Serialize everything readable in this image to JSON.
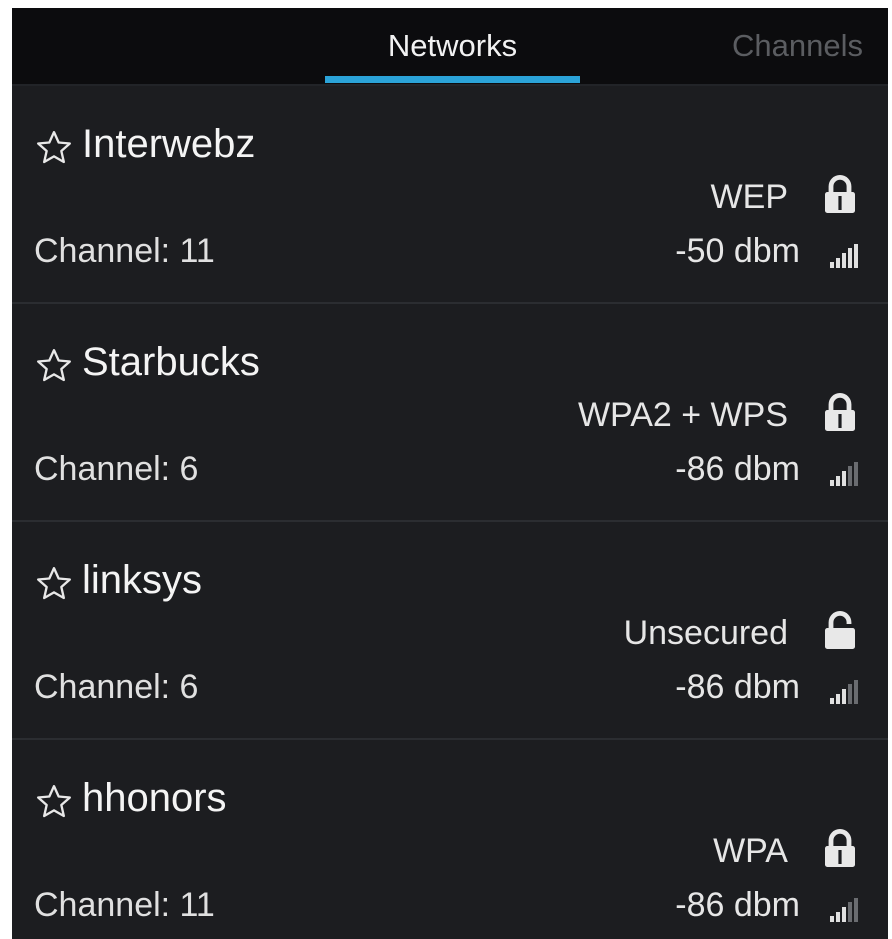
{
  "tabs": {
    "networks": "Networks",
    "channels": "Channels",
    "active": "networks"
  },
  "colors": {
    "background": "#1c1d20",
    "tabbar": "#0c0c0e",
    "accent": "#2ba3d8",
    "text": "#f2f2f2",
    "inactive_tab": "#5b5d61"
  },
  "networks": [
    {
      "ssid": "Interwebz",
      "security": "WEP",
      "channel": "Channel: 11",
      "signal": "-50 dbm",
      "star_icon": "star-outline-icon",
      "lock_icon": "lock-closed-icon",
      "signal_icon": "signal-bars-icon"
    },
    {
      "ssid": "Starbucks",
      "security": "WPA2 + WPS",
      "channel": "Channel: 6",
      "signal": "-86 dbm",
      "star_icon": "star-outline-icon",
      "lock_icon": "lock-closed-icon",
      "signal_icon": "signal-bars-icon"
    },
    {
      "ssid": "linksys",
      "security": "Unsecured",
      "channel": "Channel: 6",
      "signal": "-86 dbm",
      "star_icon": "star-outline-icon",
      "lock_icon": "lock-open-icon",
      "signal_icon": "signal-bars-icon"
    },
    {
      "ssid": "hhonors",
      "security": "WPA",
      "channel": "Channel: 11",
      "signal": "-86 dbm",
      "star_icon": "star-outline-icon",
      "lock_icon": "lock-closed-icon",
      "signal_icon": "signal-bars-icon"
    }
  ]
}
